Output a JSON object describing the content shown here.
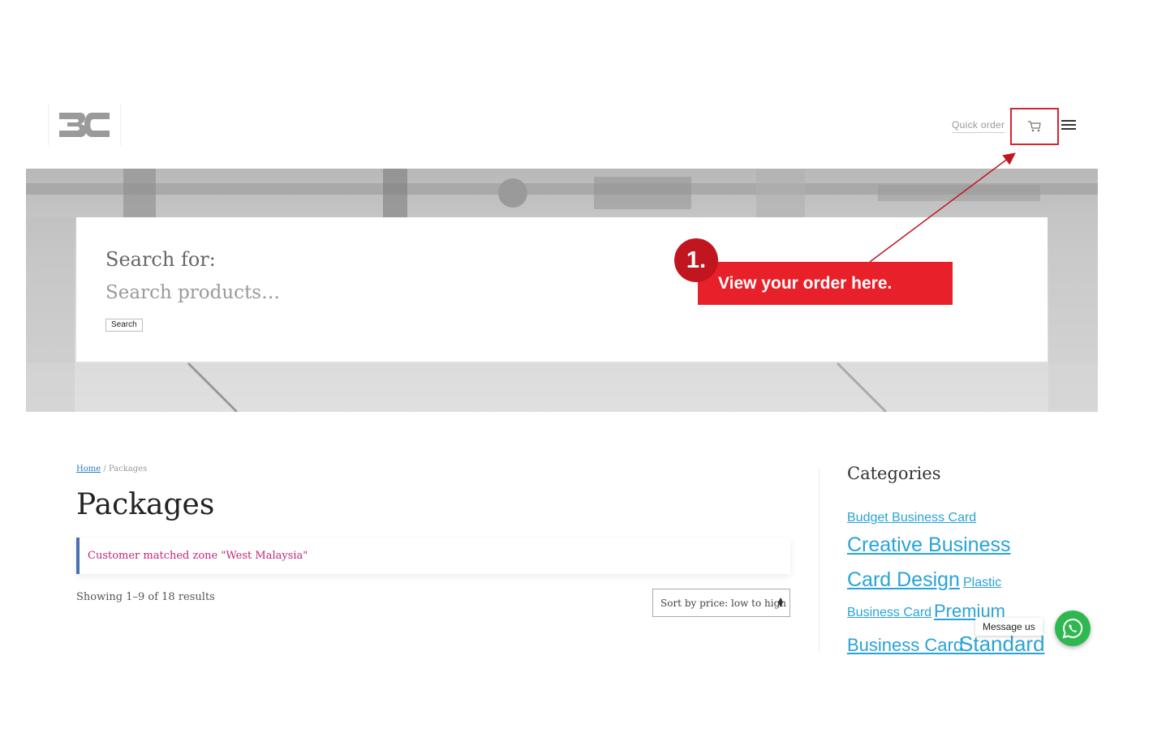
{
  "header": {
    "logo_text": "BC",
    "quick_order_label": "Quick order",
    "cart_icon": "cart-icon",
    "menu_icon": "hamburger-menu-icon"
  },
  "search": {
    "label": "Search for:",
    "placeholder": "Search products…",
    "button_label": "Search"
  },
  "callout": {
    "number": "1.",
    "text": "View your order here.",
    "color": "#e8202a"
  },
  "breadcrumb": {
    "home": "Home",
    "separator": " / ",
    "current": "Packages"
  },
  "page": {
    "title": "Packages",
    "notice": "Customer matched zone \"West Malaysia\"",
    "result_count": "Showing 1–9 of 18 results",
    "sort_selected": "Sort by price: low to high"
  },
  "sidebar": {
    "title": "Categories",
    "tags": [
      "Budget Business Card",
      "Creative Business",
      "Card Design",
      "Plastic",
      "Business Card",
      "Premium",
      "Business Card",
      "Standard"
    ]
  },
  "whatsapp": {
    "label": "Message us",
    "icon": "whatsapp-icon",
    "color": "#2fb84f"
  }
}
